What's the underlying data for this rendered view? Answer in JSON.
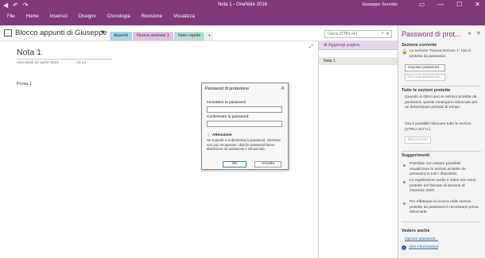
{
  "window": {
    "title": "Nota 1 - OneNote 2016",
    "user": "Giuseppe Servidio",
    "back_icon": "◀",
    "undo_icon": "↶",
    "redo_icon": "↷",
    "help_icon": "?",
    "restore_icon": "▭",
    "minimize_icon": "—",
    "maximize_icon": "☐",
    "close_icon": "✕"
  },
  "ribbon": {
    "tabs": [
      "File",
      "Home",
      "Inserisci",
      "Disegno",
      "Cronologia",
      "Revisione",
      "Visualizza"
    ]
  },
  "notebook": {
    "name": "Blocco appunti di Giuseppe",
    "chevron": "▼"
  },
  "sections": [
    {
      "label": "Assenti",
      "color": "#a9d3ee"
    },
    {
      "label": "Nuova sezione 1",
      "color": "#e3bfe6"
    },
    {
      "label": "Note rapide",
      "color": "#b5dfd6"
    }
  ],
  "add_section": "+",
  "search": {
    "placeholder": "Cerca (CTRL+E)",
    "icon": "⌕",
    "chevron": "▼"
  },
  "page": {
    "title": "Nota 1",
    "date": "mercoledì 18 aprile 2018",
    "time": "13.14",
    "body": "Prova 1",
    "expand_icon": "⤢"
  },
  "pages_pane": {
    "add_page": "Aggiungi pagina",
    "add_icon": "⊕",
    "items": [
      "Nota 1"
    ]
  },
  "task_pane": {
    "title": "Password di prot...",
    "chevron": "▼",
    "close": "✕",
    "current_section": {
      "title": "Sezione corrente",
      "lock_icon": "🔒",
      "text": "La sezione \"Nuova sezione 1\" non è protetta da password.",
      "set_button": "Imposta password...",
      "remove_button": "Rimuovi password..."
    },
    "all_sections": {
      "title": "Tutte le sezioni protette",
      "text1": "Quando si sbloccano le sezioni protette da password, queste rimangono sbloccate per un determinato periodo di tempo.",
      "text2": "Ora è possibile bloccare tutte le sezioni. (CTRL+ALT+L)",
      "lock_all_button": "Blocca tutte"
    },
    "tips": {
      "title": "Suggerimenti",
      "items": [
        "Potrebbe non essere possibile visualizzare le sezioni protette da password in tutti i dispositivi.",
        "Le registrazioni audio e video non sono protette nel formato di sezione di OneNote 2007.",
        "Per effettuare la ricerca nelle sezioni protette da password è necessario prima sbloccarle."
      ]
    },
    "see_also": {
      "title": "Vedere anche",
      "link1": "Opzioni password...",
      "link2": "Altre informazioni",
      "info_icon": "i"
    }
  },
  "dialog": {
    "title": "Password di protezione",
    "close": "✕",
    "enter_label": "Immettere la password:",
    "confirm_label": "Confermare la password:",
    "warn_icon": "⚠",
    "warn_title": "Attenzione",
    "warn_text": "Se si perde o si dimentica la password, OneNote non può recuperare i dati (le password fanno distinzione tra maiuscole e minuscole).",
    "ok": "OK",
    "cancel": "Annulla"
  }
}
